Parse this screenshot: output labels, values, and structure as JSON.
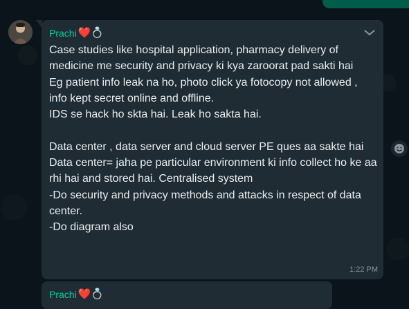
{
  "chat": {
    "messages": [
      {
        "sender": "Prachi",
        "sender_emojis": "❤️💍",
        "text": "Case studies like hospital application, pharmacy delivery of medicine me security and privacy ki kya zaroorat pad sakti hai\nEg patient info leak na ho, photo click ya fotocopy not allowed , info kept secret online and offline.\nIDS se hack ho skta hai. Leak ho sakta hai.\n\nData center , data server and cloud server PE ques aa sakte hai\nData center= jaha pe particular environment ki info collect ho ke aa rhi hai and stored hai. Centralised system\n-Do security and privacy methods and attacks in respect of data center.\n-Do diagram also",
        "time": "1:22 PM"
      },
      {
        "sender": "Prachi",
        "sender_emojis": "❤️💍"
      }
    ]
  },
  "icons": {
    "avatar": "avatar",
    "menu": "chevron-down-icon",
    "reaction": "emoji-icon"
  },
  "colors": {
    "background": "#0b141a",
    "bubble": "#202c33",
    "outgoing": "#005c4b",
    "sender_name": "#06cf9c",
    "text": "#e9edef",
    "meta": "#8696a0"
  }
}
